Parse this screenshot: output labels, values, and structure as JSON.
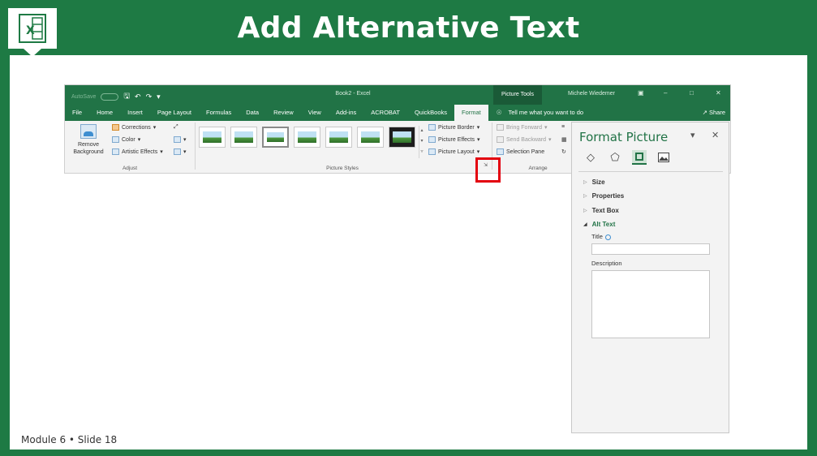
{
  "slide": {
    "title": "Add Alternative Text",
    "footer": "Module 6 • Slide 18",
    "logo_letter": "X",
    "theme_color": "#1e7a44"
  },
  "excel": {
    "autosave_label": "AutoSave",
    "doc_title": "Book2 - Excel",
    "contextual_tab_group": "Picture Tools",
    "user_name": "Michele Wiedemer",
    "accent_color": "#217346",
    "tabs": [
      {
        "label": "File"
      },
      {
        "label": "Home"
      },
      {
        "label": "Insert"
      },
      {
        "label": "Page Layout"
      },
      {
        "label": "Formulas"
      },
      {
        "label": "Data"
      },
      {
        "label": "Review"
      },
      {
        "label": "View"
      },
      {
        "label": "Add-ins"
      },
      {
        "label": "ACROBAT"
      },
      {
        "label": "QuickBooks"
      },
      {
        "label": "Format"
      }
    ],
    "active_tab": "Format",
    "tell_me": "Tell me what you want to do",
    "share": "Share",
    "ribbon": {
      "remove_background": "Remove Background",
      "corrections": "Corrections",
      "color": "Color",
      "artistic_effects": "Artistic Effects",
      "adjust_label": "Adjust",
      "picture_styles_label": "Picture Styles",
      "picture_border": "Picture Border",
      "picture_effects": "Picture Effects",
      "picture_layout": "Picture Layout",
      "bring_forward": "Bring Forward",
      "send_backward": "Send Backward",
      "selection_pane": "Selection Pane",
      "arrange_label": "Arrange"
    }
  },
  "format_pane": {
    "title": "Format Picture",
    "icons": [
      "fill-line-icon",
      "effects-icon",
      "size-properties-icon",
      "picture-icon"
    ],
    "sections": [
      {
        "label": "Size",
        "expanded": false
      },
      {
        "label": "Properties",
        "expanded": false
      },
      {
        "label": "Text Box",
        "expanded": false
      },
      {
        "label": "Alt Text",
        "expanded": true
      }
    ],
    "title_field_label": "Title",
    "title_value": "",
    "description_label": "Description",
    "description_value": ""
  }
}
